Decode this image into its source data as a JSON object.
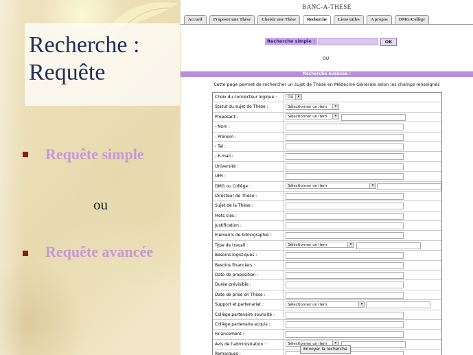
{
  "slide": {
    "title_line1": "Recherche :",
    "title_line2": "Requête",
    "bullets": [
      "Requête simple",
      "Requête avancée"
    ],
    "separator": "ou",
    "colors": {
      "title": "#1f2e5a",
      "bullet_text": "#c59ad6",
      "bullet": "#8b1a1a"
    }
  },
  "site": {
    "title": "BANC-A-THESE",
    "tabs": [
      "Accueil",
      "Proposer une Thèse",
      "Choisir une Thèse",
      "Recherche",
      "Liens utiles",
      "A propos",
      "DMG/Collège"
    ],
    "active_tab": "Recherche"
  },
  "search_simple": {
    "label": "Recherche simple :",
    "ok_label": "OK",
    "separator": "OU"
  },
  "search_advanced": {
    "header": "Recherche avancée :",
    "intro": "Cette page permet de rechercher un sujet de Thèse en Médecine Générale selon les champs renseignés",
    "select_placeholder": "Sélectionner un item",
    "connector_value": "OU",
    "fields": [
      "Choix du connecteur logique :",
      "Statut du sujet de Thèse :",
      "Proposant :",
      "- Nom :",
      "- Prénom :",
      "- Tel :",
      "- E-mail :",
      "Université :",
      "UFR :",
      "DMG ou Collège :",
      "Directeur de Thèse :",
      "Sujet de la Thèse :",
      "Mots clés :",
      "Justification :",
      "Eléments de bibliographie :",
      "Type de travail :",
      "Besoins logistiques :",
      "Besoins financiers :",
      "Date de proposition :",
      "Durée prévisible :",
      "Date de prise en Thèse :",
      "Support et partenariat :",
      "Collège partenaire souhaité :",
      "Collège partenaire acquis :",
      "Financement :",
      "Avis de l'administration :",
      "Remarques :"
    ],
    "submit_label": "Envoyer la recherche"
  }
}
